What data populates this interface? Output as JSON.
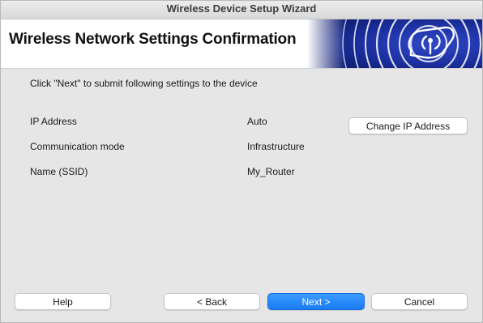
{
  "window": {
    "title": "Wireless Device Setup Wizard"
  },
  "banner": {
    "heading": "Wireless Network Settings Confirmation",
    "logo_icon": "wireless-signal-icon",
    "accent_color": "#1b2f9e"
  },
  "main": {
    "instruction": "Click \"Next\" to submit following settings to the device",
    "settings": [
      {
        "label": "IP Address",
        "value": "Auto"
      },
      {
        "label": "Communication mode",
        "value": "Infrastructure"
      },
      {
        "label": "Name (SSID)",
        "value": "My_Router"
      }
    ],
    "change_ip_label": "Change IP Address"
  },
  "footer": {
    "help_label": "Help",
    "back_label": "< Back",
    "next_label": "Next >",
    "cancel_label": "Cancel",
    "primary_color": "#1a7cf5"
  }
}
